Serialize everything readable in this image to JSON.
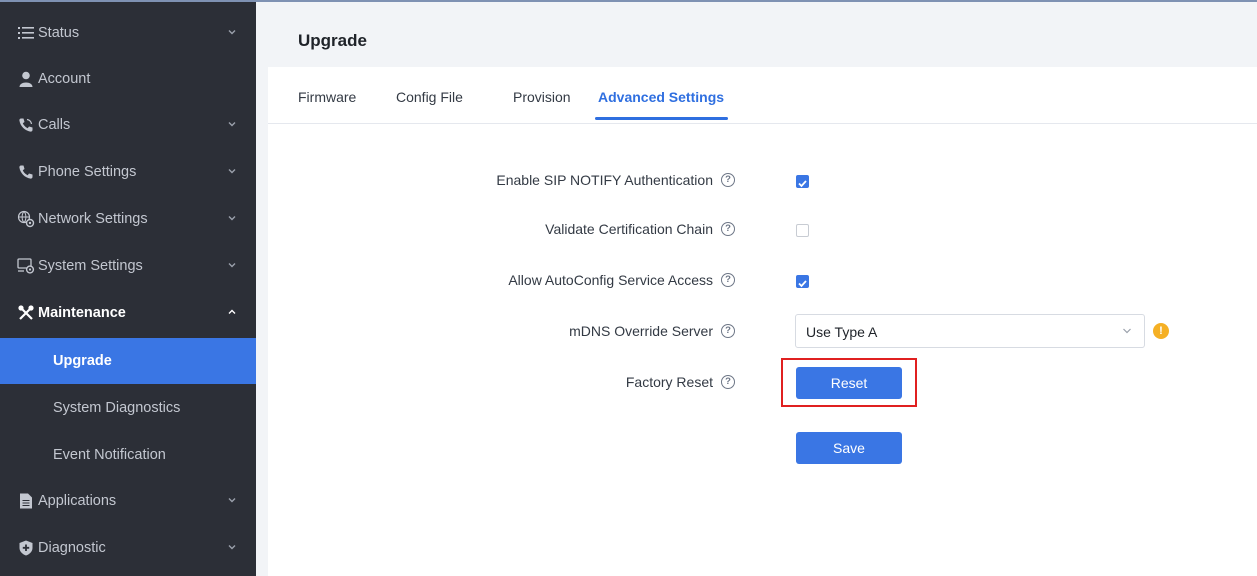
{
  "sidebar": {
    "items": [
      {
        "label": "Status",
        "icon": "list-icon"
      },
      {
        "label": "Account",
        "icon": "user-icon"
      },
      {
        "label": "Calls",
        "icon": "call-icon"
      },
      {
        "label": "Phone Settings",
        "icon": "phone-icon"
      },
      {
        "label": "Network Settings",
        "icon": "network-gear-icon"
      },
      {
        "label": "System Settings",
        "icon": "system-gear-icon"
      },
      {
        "label": "Maintenance",
        "icon": "tools-icon"
      },
      {
        "label": "Applications",
        "icon": "document-icon"
      },
      {
        "label": "Diagnostic",
        "icon": "shield-plus-icon"
      }
    ],
    "sub_items": [
      {
        "label": "Upgrade"
      },
      {
        "label": "System Diagnostics"
      },
      {
        "label": "Event Notification"
      }
    ]
  },
  "main": {
    "title": "Upgrade",
    "tabs": [
      {
        "label": "Firmware"
      },
      {
        "label": "Config File"
      },
      {
        "label": "Provision"
      },
      {
        "label": "Advanced Settings"
      }
    ],
    "fields": {
      "sip_notify": {
        "label": "Enable SIP NOTIFY Authentication",
        "checked": true
      },
      "cert_chain": {
        "label": "Validate Certification Chain",
        "checked": false
      },
      "autoconfig": {
        "label": "Allow AutoConfig Service Access",
        "checked": true
      },
      "mdns": {
        "label": "mDNS Override Server",
        "value": "Use Type A"
      },
      "factory_reset": {
        "label": "Factory Reset",
        "button": "Reset"
      }
    },
    "save_label": "Save"
  },
  "colors": {
    "accent": "#3a76e4",
    "sidebar_bg": "#2c2f37",
    "warning": "#f5b025",
    "highlight": "#e02020"
  }
}
